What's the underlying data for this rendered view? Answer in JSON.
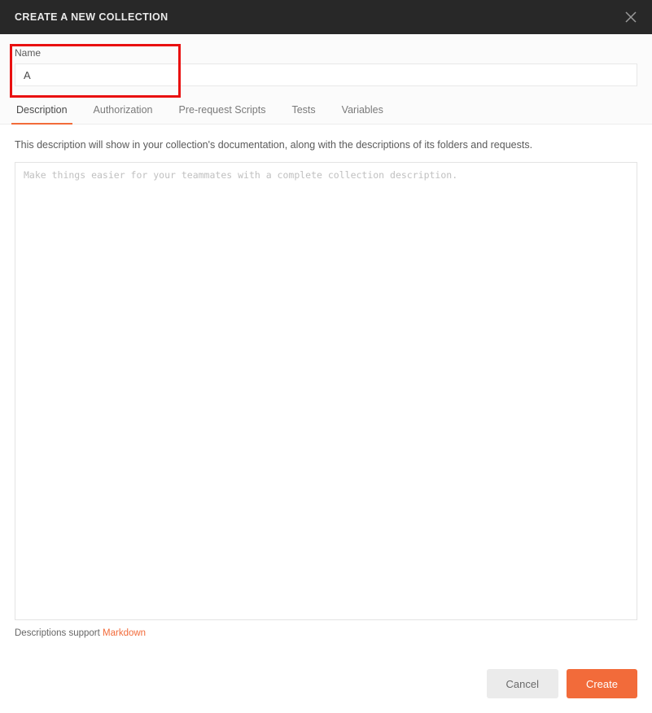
{
  "header": {
    "title": "CREATE A NEW COLLECTION"
  },
  "name_field": {
    "label": "Name",
    "value": "A"
  },
  "tabs": {
    "items": [
      {
        "label": "Description",
        "active": true
      },
      {
        "label": "Authorization",
        "active": false
      },
      {
        "label": "Pre-request Scripts",
        "active": false
      },
      {
        "label": "Tests",
        "active": false
      },
      {
        "label": "Variables",
        "active": false
      }
    ]
  },
  "description_tab": {
    "hint": "This description will show in your collection's documentation, along with the descriptions of its folders and requests.",
    "placeholder": "Make things easier for your teammates with a complete collection description.",
    "value": "",
    "footer_prefix": "Descriptions support ",
    "footer_link": "Markdown"
  },
  "footer": {
    "cancel": "Cancel",
    "create": "Create"
  },
  "colors": {
    "accent": "#f26b3a",
    "highlight": "#e91010"
  }
}
